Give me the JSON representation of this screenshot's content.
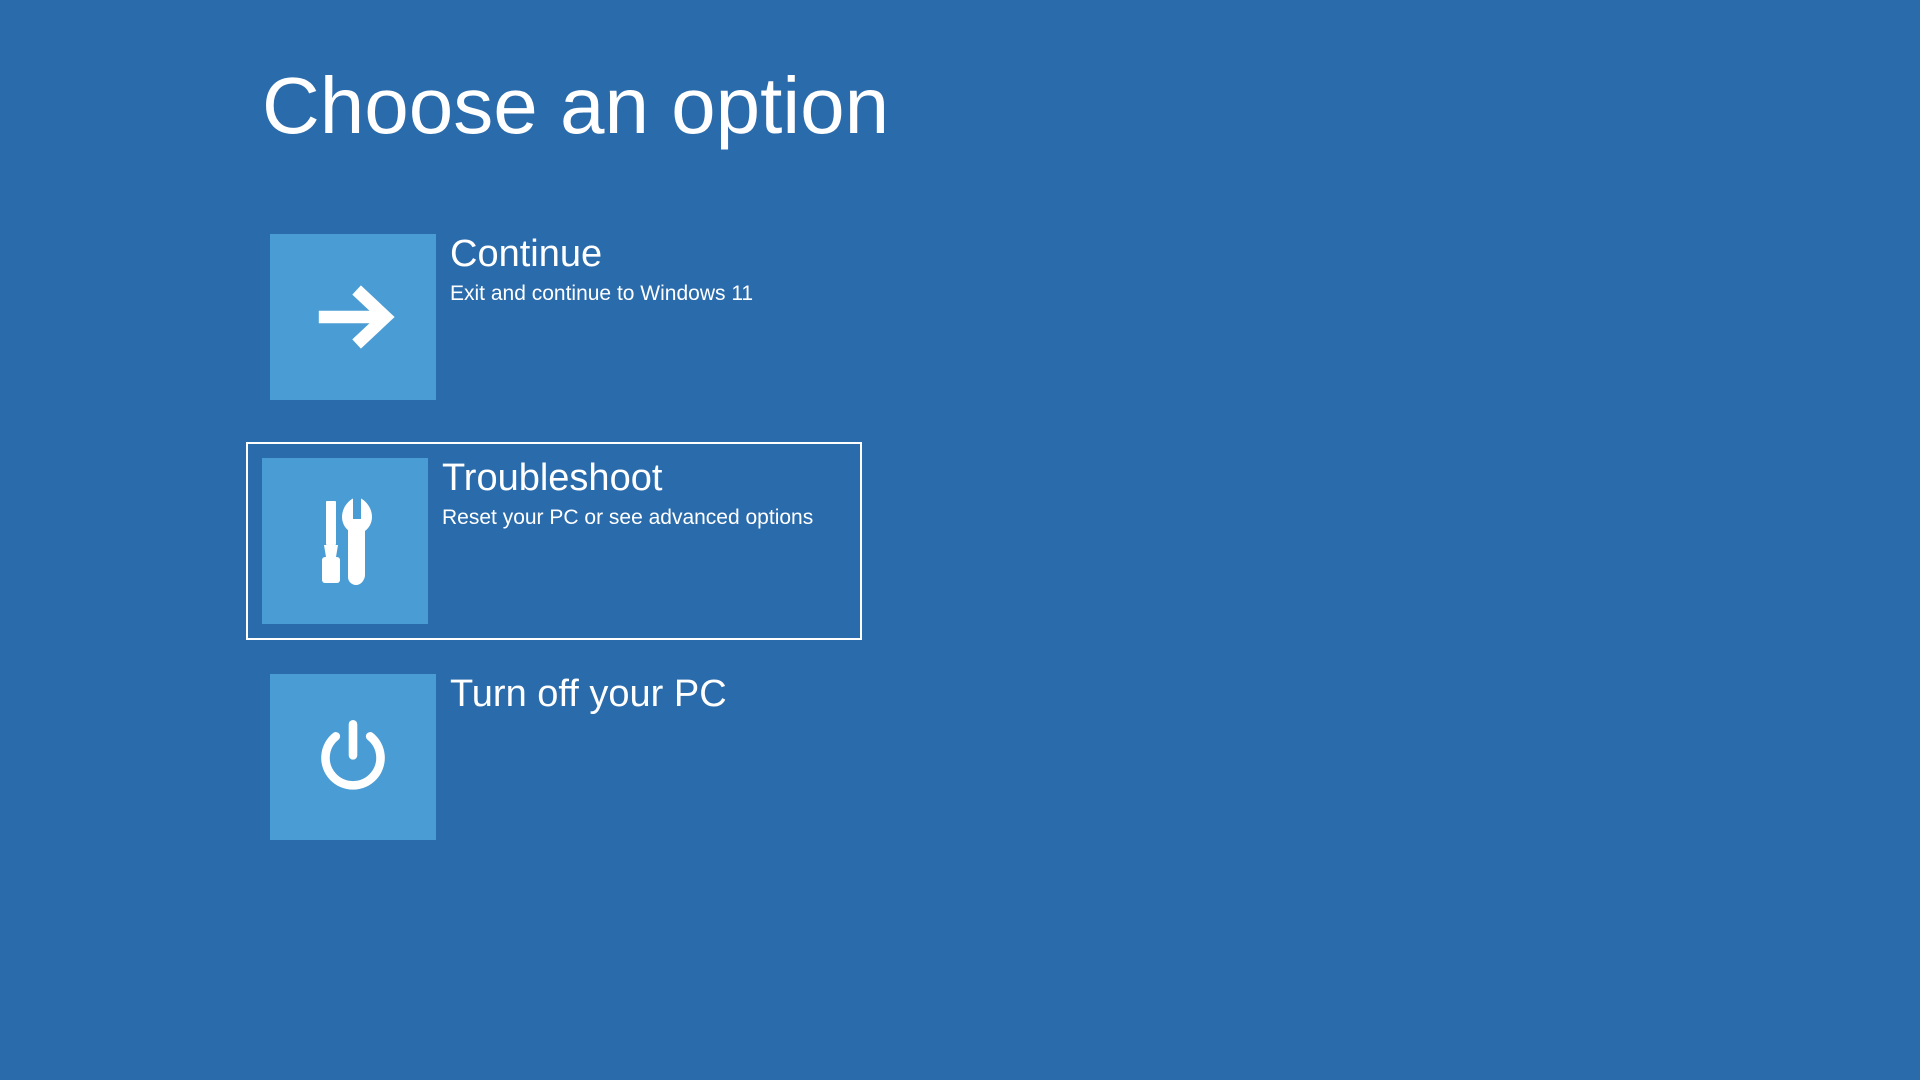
{
  "title": "Choose an option",
  "options": {
    "continue": {
      "title": "Continue",
      "desc": "Exit and continue to Windows 11"
    },
    "troubleshoot": {
      "title": "Troubleshoot",
      "desc": "Reset your PC or see advanced options"
    },
    "turnoff": {
      "title": "Turn off your PC"
    }
  }
}
